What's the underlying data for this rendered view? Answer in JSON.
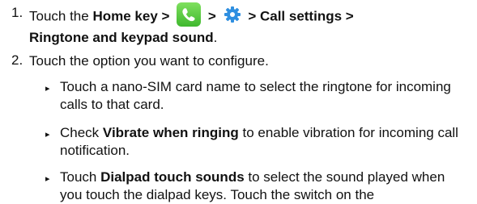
{
  "steps": [
    {
      "num": "1.",
      "parts": {
        "a": "Touch the ",
        "home": "Home",
        "b": " key >",
        "c": ">",
        "call_settings": "> Call settings >",
        "ringtone": "Ringtone and keypad sound",
        "end": "."
      }
    },
    {
      "num": "2.",
      "text": "Touch the option you want to configure."
    }
  ],
  "bullets": [
    {
      "bullet": "▸",
      "text": "Touch a nano-SIM card name to select the ringtone for incoming calls to that card."
    },
    {
      "bullet": "▸",
      "pre": "Check ",
      "bold": "Vibrate when ringing",
      "post": " to enable vibration for incoming call notification."
    },
    {
      "bullet": "▸",
      "pre": "Touch ",
      "bold": "Dialpad touch sounds",
      "post": " to select the sound played when you touch the dialpad keys. Touch the switch on the"
    }
  ],
  "icons": {
    "phone": "phone-icon",
    "gear": "gear-icon",
    "phone_color": "#4cc43a",
    "gear_color": "#2f8fe0"
  }
}
